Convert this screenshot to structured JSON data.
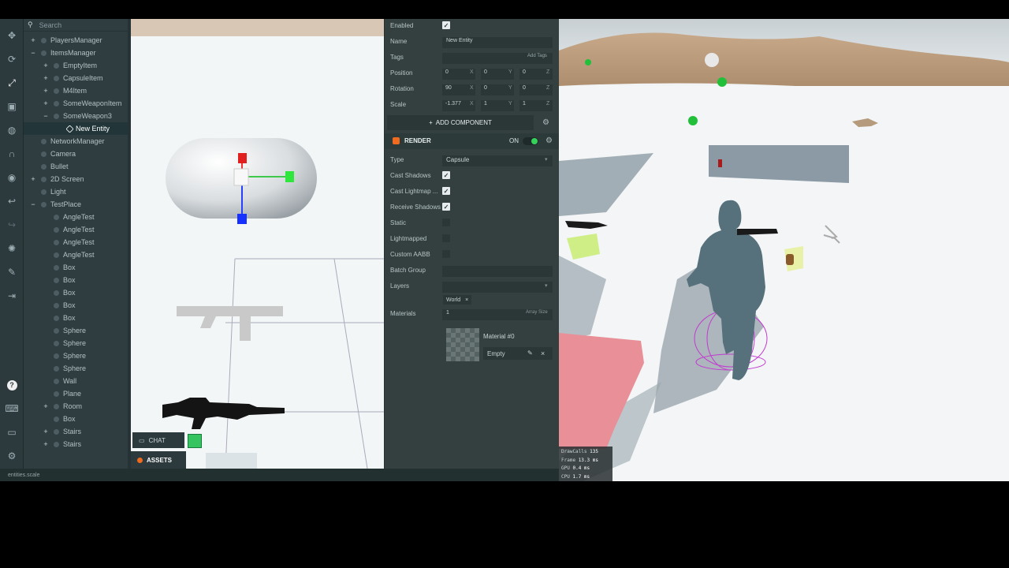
{
  "toolbar": {
    "tools": [
      "move-icon",
      "rotate-icon",
      "scale-icon",
      "resize-icon",
      "world-icon",
      "magnet-icon",
      "view-icon",
      "history-icon",
      "undo-icon",
      "light-icon",
      "edit-icon",
      "publish-icon"
    ],
    "bottom": [
      "help-icon",
      "keyboard-icon",
      "chat-icon",
      "settings-icon"
    ]
  },
  "hierarchy": {
    "search_placeholder": "Search",
    "items": [
      {
        "label": "PlayersManager",
        "expander": "+"
      },
      {
        "label": "ItemsManager",
        "expander": "−"
      },
      {
        "label": "EmptyItem",
        "expander": "+"
      },
      {
        "label": "CapsuleItem",
        "expander": "+"
      },
      {
        "label": "M4Item",
        "expander": "+"
      },
      {
        "label": "SomeWeaponItem",
        "expander": "+"
      },
      {
        "label": "SomeWeapon3",
        "expander": "−"
      },
      {
        "label": "New Entity",
        "expander": ""
      },
      {
        "label": "NetworkManager",
        "expander": ""
      },
      {
        "label": "Camera",
        "expander": ""
      },
      {
        "label": "Bullet",
        "expander": ""
      },
      {
        "label": "2D Screen",
        "expander": "+"
      },
      {
        "label": "Light",
        "expander": ""
      },
      {
        "label": "TestPlace",
        "expander": "−"
      },
      {
        "label": "AngleTest",
        "expander": ""
      },
      {
        "label": "AngleTest",
        "expander": ""
      },
      {
        "label": "AngleTest",
        "expander": ""
      },
      {
        "label": "AngleTest",
        "expander": ""
      },
      {
        "label": "Box",
        "expander": ""
      },
      {
        "label": "Box",
        "expander": ""
      },
      {
        "label": "Box",
        "expander": ""
      },
      {
        "label": "Box",
        "expander": ""
      },
      {
        "label": "Box",
        "expander": ""
      },
      {
        "label": "Sphere",
        "expander": ""
      },
      {
        "label": "Sphere",
        "expander": ""
      },
      {
        "label": "Sphere",
        "expander": ""
      },
      {
        "label": "Sphere",
        "expander": ""
      },
      {
        "label": "Wall",
        "expander": ""
      },
      {
        "label": "Plane",
        "expander": ""
      },
      {
        "label": "Room",
        "expander": "+"
      },
      {
        "label": "Box",
        "expander": ""
      },
      {
        "label": "Stairs",
        "expander": "+"
      },
      {
        "label": "Stairs",
        "expander": "+"
      }
    ]
  },
  "viewport": {
    "chat_label": "CHAT",
    "assets_label": "ASSETS"
  },
  "inspector": {
    "enabled_label": "Enabled",
    "name_label": "Name",
    "name_value": "New Entity",
    "tags_label": "Tags",
    "add_tags": "Add Tags",
    "position_label": "Position",
    "position": [
      "0",
      "0",
      "0"
    ],
    "rotation_label": "Rotation",
    "rotation": [
      "90",
      "0",
      "0"
    ],
    "scale_label": "Scale",
    "scale": [
      "-1.377",
      "1",
      "1"
    ],
    "axes": [
      "X",
      "Y",
      "Z"
    ],
    "add_component": "ADD COMPONENT",
    "render": {
      "title": "RENDER",
      "on_label": "ON",
      "type_label": "Type",
      "type_value": "Capsule",
      "cast_shadows": "Cast Shadows",
      "cast_lightmap": "Cast Lightmap ...",
      "receive_shadows": "Receive Shadows",
      "static": "Static",
      "lightmapped": "Lightmapped",
      "custom_aabb": "Custom AABB",
      "batch_group": "Batch Group",
      "layers": "Layers",
      "layer_chip": "World",
      "materials_label": "Materials",
      "materials_count": "1",
      "array_size": "Array Size",
      "material_slot": "Material #0",
      "material_value": "Empty"
    }
  },
  "stats": {
    "drawcalls_label": "DrawCalls",
    "drawcalls": "135",
    "frame_label": "Frame",
    "frame": "13.3 ms",
    "gpu_label": "GPU",
    "gpu": "0.4 ms",
    "cpu_label": "CPU",
    "cpu": "1.7 ms"
  },
  "status": {
    "text": "entities.scale"
  },
  "colors": {
    "panel": "#2f3d41",
    "inspector": "#33403f",
    "accent_orange": "#ef6b1f",
    "toggle_green": "#36d15b"
  }
}
